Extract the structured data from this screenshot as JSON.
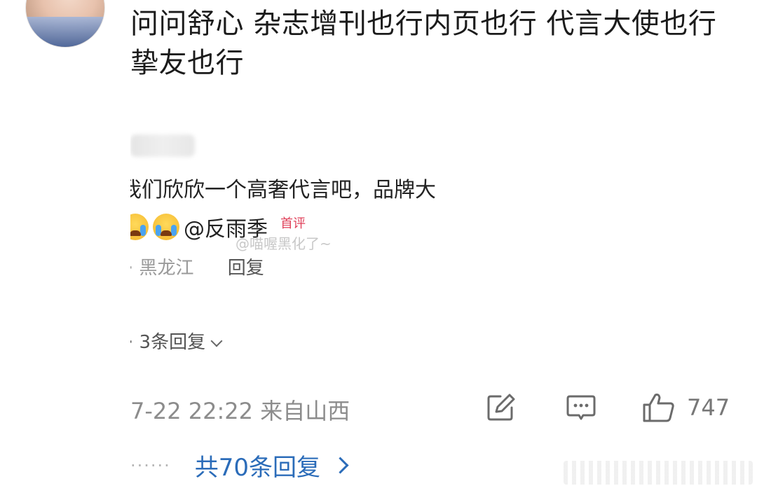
{
  "comment": {
    "text": "问问舒心  杂志增刊也行内页也行  代言大使也行挚友也行"
  },
  "quoted": {
    "line": "我们欣欣一个高奢代言吧，品牌大",
    "mention": "@反雨季",
    "badge": "首评",
    "watermark": "@喵喔黑化了~",
    "location": "· 黑龙江",
    "reply": "回复",
    "more_replies": "· 3条回复"
  },
  "footer": {
    "time": "7-22 22:22 来自山西",
    "like_count": "747"
  },
  "all_replies": {
    "dots": "······",
    "label": "共70条回复"
  },
  "colors": {
    "link": "#2b6cb9",
    "badge": "#e0415a",
    "meta": "#8c8c8c"
  },
  "icons": [
    "share-icon",
    "comment-icon",
    "like-icon",
    "chevron-down-icon",
    "chevron-right-icon",
    "cry-emoji-icon"
  ]
}
